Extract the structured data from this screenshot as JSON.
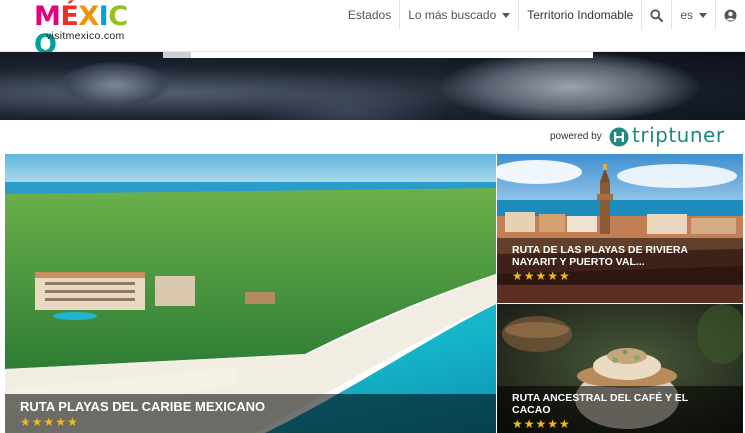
{
  "brand": {
    "logo_letters": [
      "M",
      "É",
      "X",
      "I",
      "C",
      "O"
    ],
    "logo_colors": [
      "#e5007e",
      "#e5312b",
      "#f39200",
      "#009fe3",
      "#95c11f",
      "#00a19a"
    ],
    "site": "visitmexico.com"
  },
  "nav": {
    "items": [
      {
        "label": "Estados",
        "dropdown": false
      },
      {
        "label": "Lo más buscado",
        "dropdown": true
      },
      {
        "label": "Territorio Indomable",
        "dropdown": false
      }
    ],
    "search_icon": "search-icon",
    "language": "es",
    "user_icon": "user-circle-icon"
  },
  "powered": {
    "label": "powered by",
    "partner": "triptuner",
    "accent": "#1f8a80"
  },
  "cards": [
    {
      "title": "RUTA PLAYAS DEL CARIBE MEXICANO",
      "stars": "★★★★★",
      "rating": 5
    },
    {
      "title": "RUTA DE LAS PLAYAS DE RIVIERA NAYARIT Y PUERTO VAL...",
      "stars": "★★★★★",
      "rating": 5
    },
    {
      "title": "RUTA ANCESTRAL DEL CAFÉ Y EL CACAO",
      "stars": "★★★★★",
      "rating": 5
    }
  ]
}
